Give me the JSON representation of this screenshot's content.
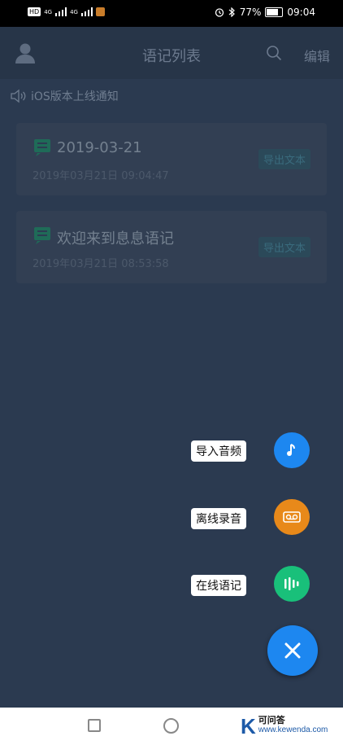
{
  "status_bar": {
    "net_chip": "HD",
    "signal_label_1": "4G",
    "signal_label_2": "4G",
    "battery_pct": "77%",
    "time": "09:04"
  },
  "header": {
    "title": "语记列表",
    "edit_label": "编辑"
  },
  "notice": {
    "text": "iOS版本上线通知"
  },
  "cards": [
    {
      "title": "2019-03-21",
      "time": "2019年03月21日 09:04:47",
      "export_label": "导出文本"
    },
    {
      "title": "欢迎来到息息语记",
      "time": "2019年03月21日 08:53:58",
      "export_label": "导出文本"
    }
  ],
  "fab_menu": {
    "items": [
      {
        "label": "导入音频",
        "icon": "music-note-icon",
        "color": "#1d87f0"
      },
      {
        "label": "离线录音",
        "icon": "voicemail-icon",
        "color": "#e8891a"
      },
      {
        "label": "在线语记",
        "icon": "sound-wave-icon",
        "color": "#19c07a"
      }
    ],
    "close_icon": "close-icon",
    "main_color": "#1d87f0"
  },
  "watermark": {
    "letter": "K",
    "name": "可问答",
    "url": "www.kewenda.com"
  }
}
